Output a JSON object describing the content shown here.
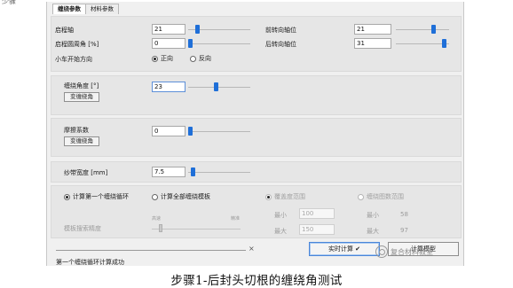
{
  "corner_text": "少骤",
  "tabs": [
    {
      "label": "缠绕参数",
      "active": true
    },
    {
      "label": "材料参数",
      "active": false
    }
  ],
  "axis_panel": {
    "start_axis": {
      "label": "启程轴",
      "value": "21",
      "level": 0.12
    },
    "start_angle": {
      "label": "启程圆周角 [%]",
      "value": "0",
      "level": 0.0
    },
    "direction": {
      "label": "小车开始方向",
      "forward": "正向",
      "reverse": "反向",
      "selected": "正向"
    },
    "front_axis": {
      "label": "前转向轴位",
      "value": "21",
      "level": 0.72
    },
    "rear_axis": {
      "label": "后转向轴位",
      "value": "31",
      "level": 0.95
    }
  },
  "winding_angle": {
    "label": "缠绕角度 [°]",
    "value": "23",
    "button": "变缠绕角",
    "level": 0.45
  },
  "friction": {
    "label": "摩擦系数",
    "value": "0",
    "button": "变缠绕角",
    "level": 0.0
  },
  "tape_width": {
    "label": "纱带宽度 [mm]",
    "value": "7.5",
    "level": 0.04
  },
  "calc": {
    "first_cycle": "计算第一个缠绕循环",
    "all_patterns": "计算全部缠绕模板",
    "selected": "计算第一个缠绕循环",
    "precision_label": "模板搜索精度",
    "precision_low": "高速",
    "precision_high": "精准",
    "range_covered": "覆盖度范围",
    "range_pattern": "缠绕图数范围",
    "min_label": "最小",
    "max_label": "最大",
    "cov_min": "100",
    "cov_max": "150",
    "pat_min": "58",
    "pat_max": "97"
  },
  "progress_close": "×",
  "realtime_button": "实时计算 ✔",
  "pattern_button": "计算模型",
  "status_text": "第一个缠绕循环计算成功",
  "watermark": "复合材料教室",
  "caption": "步骤1-后封头切根的缠绕角测试",
  "colors": {
    "accent": "#1f6fd8",
    "panel": "#e6e6e6",
    "window": "#f0f0f0"
  }
}
